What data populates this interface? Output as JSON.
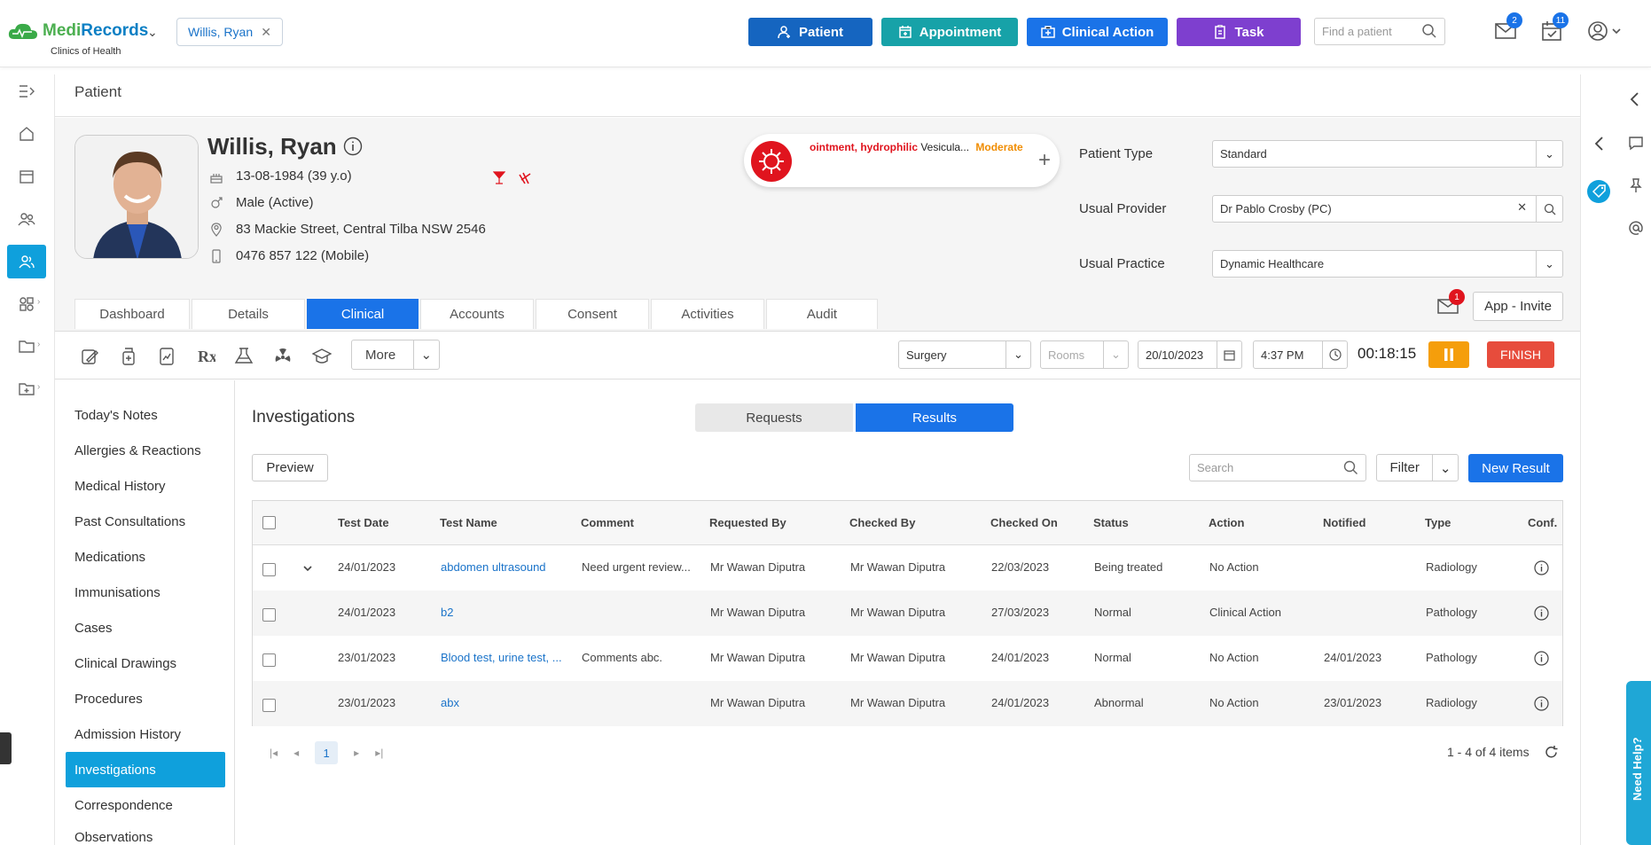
{
  "brand": {
    "name_a": "Medi",
    "name_b": "Records",
    "subtitle": "Clinics of Health"
  },
  "header": {
    "patient_chip": "Willis, Ryan",
    "buttons": {
      "patient": "Patient",
      "appointment": "Appointment",
      "clinical_action": "Clinical Action",
      "task": "Task"
    },
    "find_placeholder": "Find a patient",
    "mail_badge": "2",
    "tasks_badge": "11"
  },
  "colors": {
    "patient_btn": "#1565c0",
    "appointment_btn": "#17a2a8",
    "clinical_btn": "#1a73e8",
    "task_btn": "#7e3fcf",
    "accent": "#0fa0dc"
  },
  "page": {
    "title": "Patient"
  },
  "patient": {
    "name": "Willis, Ryan",
    "dob": "13-08-1984 (39 y.o)",
    "gender": "Male (Active)",
    "address": "83 Mackie Street, Central Tilba NSW 2546",
    "phone": "0476 857 122 (Mobile)"
  },
  "allergy": {
    "substance": "ointment, hydrophilic",
    "reaction": "Vesicula...",
    "severity": "Moderate"
  },
  "fields": {
    "patient_type_label": "Patient Type",
    "patient_type_value": "Standard",
    "usual_provider_label": "Usual Provider",
    "usual_provider_value": "Dr Pablo Crosby (PC)",
    "usual_practice_label": "Usual Practice",
    "usual_practice_value": "Dynamic Healthcare"
  },
  "tabs": [
    "Dashboard",
    "Details",
    "Clinical",
    "Accounts",
    "Consent",
    "Activities",
    "Audit"
  ],
  "mail_notice_badge": "1",
  "app_invite": "App - Invite",
  "toolbar": {
    "more": "More",
    "location": "Surgery",
    "rooms_placeholder": "Rooms",
    "date": "20/10/2023",
    "time": "4:37 PM",
    "timer": "00:18:15",
    "finish": "FINISH"
  },
  "sidemenu": [
    "Today's Notes",
    "Allergies & Reactions",
    "Medical History",
    "Past Consultations",
    "Medications",
    "Immunisations",
    "Cases",
    "Clinical Drawings",
    "Procedures",
    "Admission History",
    "Investigations",
    "Correspondence",
    "Observations"
  ],
  "investigations": {
    "title": "Investigations",
    "seg_requests": "Requests",
    "seg_results": "Results",
    "preview": "Preview",
    "search_placeholder": "Search",
    "filter": "Filter",
    "new_result": "New Result",
    "columns": [
      "Test Date",
      "Test Name",
      "Comment",
      "Requested By",
      "Checked By",
      "Checked On",
      "Status",
      "Action",
      "Notified",
      "Type",
      "Conf."
    ],
    "rows": [
      {
        "date": "24/01/2023",
        "name": "abdomen ultrasound",
        "comment": "Need urgent review...",
        "requested": "Mr Wawan Diputra",
        "checked": "Mr Wawan Diputra",
        "checked_on": "22/03/2023",
        "status": "Being treated",
        "action": "No Action",
        "notified": "",
        "type": "Radiology"
      },
      {
        "date": "24/01/2023",
        "name": "b2",
        "comment": "",
        "requested": "Mr Wawan Diputra",
        "checked": "Mr Wawan Diputra",
        "checked_on": "27/03/2023",
        "status": "Normal",
        "action": "Clinical Action",
        "notified": "",
        "type": "Pathology"
      },
      {
        "date": "23/01/2023",
        "name": "Blood test, urine test, ...",
        "comment": "Comments abc.",
        "requested": "Mr Wawan Diputra",
        "checked": "Mr Wawan Diputra",
        "checked_on": "24/01/2023",
        "status": "Normal",
        "action": "No Action",
        "notified": "24/01/2023",
        "type": "Pathology"
      },
      {
        "date": "23/01/2023",
        "name": "abx",
        "comment": "",
        "requested": "Mr Wawan Diputra",
        "checked": "Mr Wawan Diputra",
        "checked_on": "24/01/2023",
        "status": "Abnormal",
        "action": "No Action",
        "notified": "23/01/2023",
        "type": "Radiology"
      }
    ],
    "page": "1",
    "page_info": "1 - 4 of 4 items"
  },
  "help": "Need Help?"
}
